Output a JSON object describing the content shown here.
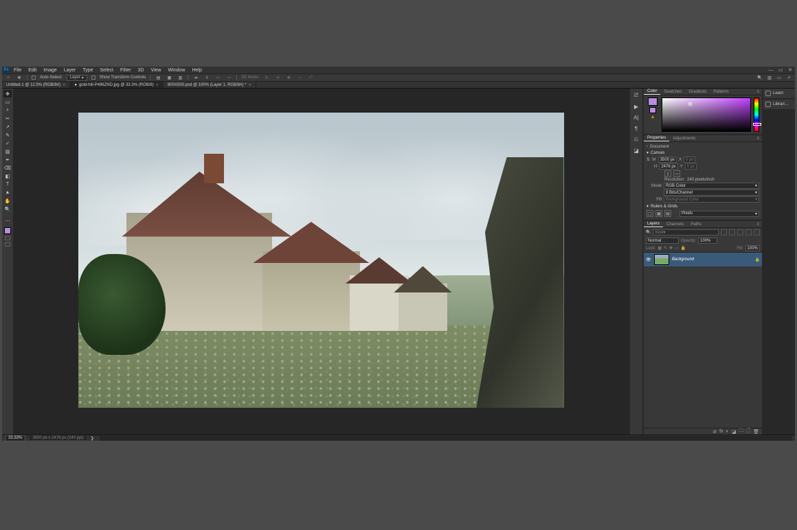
{
  "menu": {
    "items": [
      "File",
      "Edit",
      "Image",
      "Layer",
      "Type",
      "Select",
      "Filter",
      "3D",
      "View",
      "Window",
      "Help"
    ]
  },
  "winctrl": {
    "min": "—",
    "max": "▭",
    "close": "✕"
  },
  "opts": {
    "autoSelectLabel": "Auto-Select:",
    "autoSelectValue": "Layer",
    "showTransformLabel": "Show Transform Controls",
    "modeLabel": "3D Mode:"
  },
  "tabs": [
    {
      "label": "Untitled-1 @ 12.5% (RGB/8#)",
      "active": false
    },
    {
      "label": "gold-hill-P496ZND.jpg @ 33.3% (RGB/8)",
      "active": true,
      "dot": "●"
    },
    {
      "label": "800X500.psd @ 100% (Layer 1, RGB/8#) *",
      "active": false
    }
  ],
  "tools": [
    "✥",
    "▭",
    "⌕",
    "✂",
    "↗",
    "✎",
    "✓",
    "▨",
    "✒",
    "⌫",
    "◧",
    "T",
    "▲",
    "✋",
    "🔍"
  ],
  "status": {
    "zoom": "33.33%",
    "docinfo": "3500 px x 2476 px (240 ppi)",
    "chev": "❯"
  },
  "midDock": [
    "⎚",
    "▶",
    "A|",
    "¶",
    "⎌",
    "◪"
  ],
  "colorPanel": {
    "tabs": [
      "Color",
      "Swatches",
      "Gradients",
      "Patterns"
    ]
  },
  "propsPanel": {
    "tabs": [
      "Properties",
      "Adjustments"
    ],
    "docLabel": "Document",
    "section1": "Canvas",
    "w": "W",
    "wval": "3500 px",
    "x": "X",
    "xval": "0 px",
    "h": "H",
    "hval": "2476 px",
    "y": "Y",
    "yval": "0 px",
    "resLabel": "Resolution:",
    "resVal": "240 pixels/inch",
    "modeLabel": "Mode",
    "modeVal": "RGB Color",
    "bitsVal": "8 Bits/Channel",
    "fillLabel": "Fill",
    "fillVal": "Background Color",
    "section2": "Rulers & Grids",
    "unitVal": "Pixels"
  },
  "layersPanel": {
    "tabs": [
      "Layers",
      "Channels",
      "Paths"
    ],
    "kindLabel": "Kind",
    "blendVal": "Normal",
    "opacityLabel": "Opacity:",
    "opacityVal": "100%",
    "lockLabel": "Lock:",
    "fillLabel": "Fill:",
    "fillVal": "100%",
    "layers": [
      {
        "name": "Background",
        "locked": true
      }
    ],
    "footerIcons": [
      "⊘",
      "fx",
      "◐",
      "◪",
      "🗀",
      "🗋",
      "🗑"
    ]
  },
  "farDock": [
    {
      "icon": "✪",
      "label": "Learn"
    },
    {
      "icon": "▦",
      "label": "Librari…"
    }
  ],
  "topRightIcons": [
    "🔍",
    "▥",
    "▭",
    "↗"
  ]
}
